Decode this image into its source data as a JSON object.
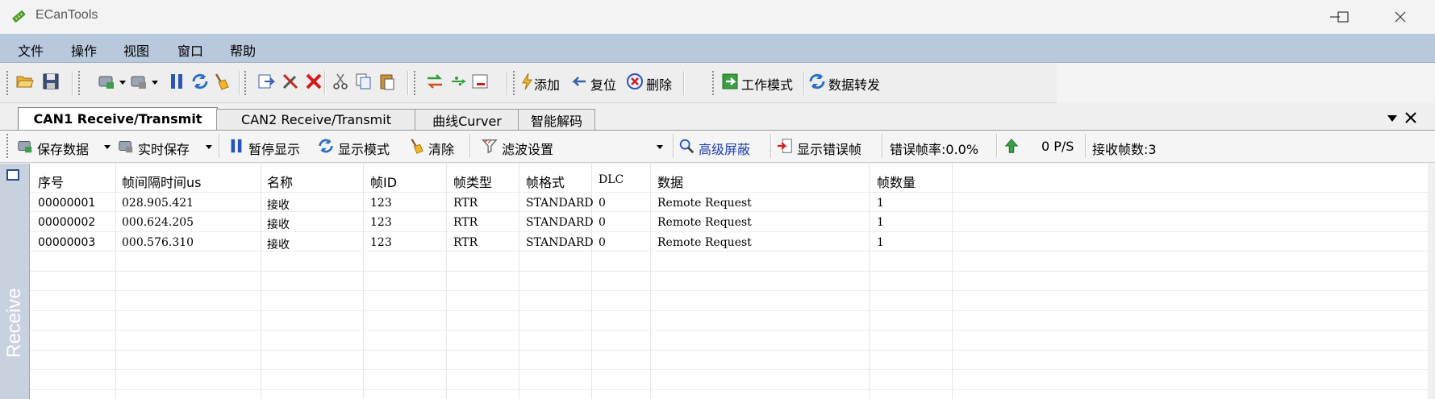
{
  "window": {
    "title": "ECanTools"
  },
  "menu": {
    "items": [
      "文件",
      "操作",
      "视图",
      "窗口",
      "帮助"
    ]
  },
  "toolbar": {
    "add_label": "添加",
    "reset_label": "复位",
    "delete_label": "删除",
    "work_mode_label": "工作模式",
    "data_forward_label": "数据转发"
  },
  "tabs": [
    {
      "label": "CAN1 Receive/Transmit",
      "active": true
    },
    {
      "label": "CAN2 Receive/Transmit",
      "active": false
    },
    {
      "label": "曲线Curver",
      "active": false
    },
    {
      "label": "智能解码",
      "active": false
    }
  ],
  "can_toolbar": {
    "save_data": "保存数据",
    "realtime_save": "实时保存",
    "pause_display": "暂停显示",
    "display_mode": "显示模式",
    "clear": "清除",
    "filter_settings": "滤波设置",
    "advanced_mask": "高级屏蔽",
    "show_error_frames": "显示错误帧",
    "error_rate": "错误帧率:0.0%",
    "rate": "0 P/S",
    "received_count": "接收帧数:3"
  },
  "side": {
    "label": "Receive"
  },
  "grid": {
    "columns": [
      "序号",
      "帧间隔时间us",
      "名称",
      "帧ID",
      "帧类型",
      "帧格式",
      "DLC",
      "数据",
      "帧数量"
    ],
    "rows": [
      [
        "00000001",
        "028.905.421",
        "接收",
        "123",
        "RTR",
        "STANDARD",
        "0",
        "Remote Request",
        "1"
      ],
      [
        "00000002",
        "000.624.205",
        "接收",
        "123",
        "RTR",
        "STANDARD",
        "0",
        "Remote Request",
        "1"
      ],
      [
        "00000003",
        "000.576.310",
        "接收",
        "123",
        "RTR",
        "STANDARD",
        "0",
        "Remote Request",
        "1"
      ]
    ]
  },
  "colors": {
    "menubar": "#b9c9dd",
    "accent_blue": "#1f3fae",
    "side_strip": "#c8d2de"
  }
}
